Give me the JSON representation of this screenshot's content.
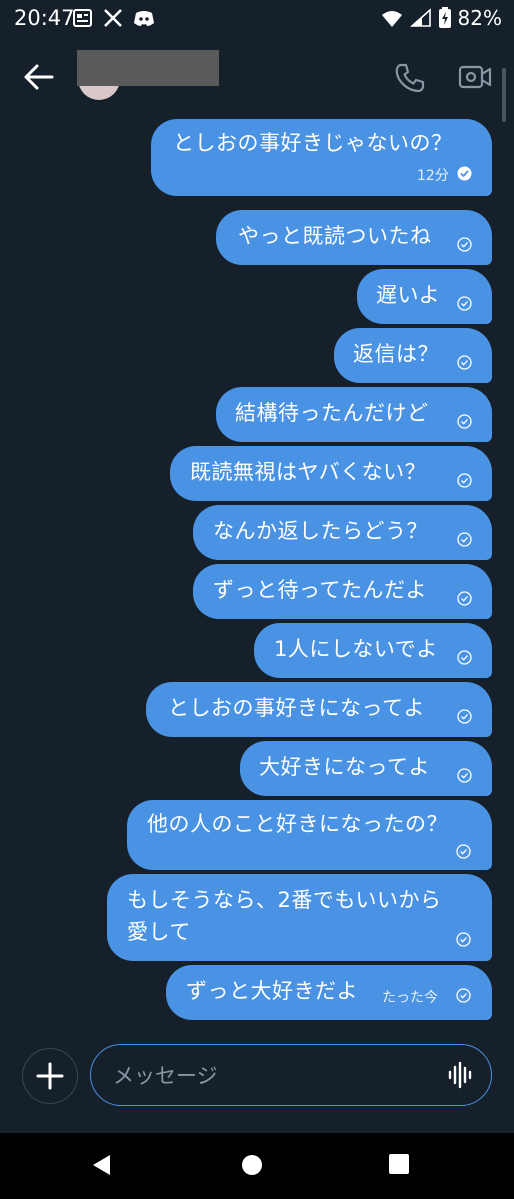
{
  "status_bar": {
    "time": "20:47",
    "battery_percent": "82%",
    "icons": [
      "news-icon",
      "x-logo-icon",
      "discord-icon",
      "wifi-icon",
      "signal-icon",
      "battery-icon"
    ]
  },
  "header": {
    "back_icon": "arrow-left-icon",
    "call_icon": "phone-icon",
    "video_icon": "video-camera-icon"
  },
  "messages": [
    {
      "text": "としおの事好きじゃないの？",
      "time": "12分",
      "status": "read"
    },
    {
      "text": "やっと既読ついたね",
      "time": "",
      "status": "sent"
    },
    {
      "text": "遅いよ",
      "time": "",
      "status": "sent"
    },
    {
      "text": "返信は？",
      "time": "",
      "status": "sent"
    },
    {
      "text": "結構待ったんだけど",
      "time": "",
      "status": "sent"
    },
    {
      "text": "既読無視はヤバくない？",
      "time": "",
      "status": "sent"
    },
    {
      "text": "なんか返したらどう？",
      "time": "",
      "status": "sent"
    },
    {
      "text": "ずっと待ってたんだよ",
      "time": "",
      "status": "sent"
    },
    {
      "text": "1人にしないでよ",
      "time": "",
      "status": "sent"
    },
    {
      "text": "としおの事好きになってよ",
      "time": "",
      "status": "sent"
    },
    {
      "text": "大好きになってよ",
      "time": "",
      "status": "sent"
    },
    {
      "text": "他の人のこと好きになったの？",
      "time": "",
      "status": "sent"
    },
    {
      "text": "もしそうなら、2番でもいいから\n愛して",
      "time": "",
      "status": "sent"
    },
    {
      "text": "ずっと大好きだよ",
      "time": "たった今",
      "status": "sent"
    }
  ],
  "composer": {
    "placeholder": "メッセージ",
    "add_icon": "plus-icon",
    "voice_icon": "voice-waveform-icon"
  },
  "nav_bar": {
    "icons": [
      "back-triangle-icon",
      "home-circle-icon",
      "recents-square-icon"
    ]
  },
  "colors": {
    "background": "#15202b",
    "bubble": "#4a93e4",
    "accent": "#4a93e4"
  }
}
